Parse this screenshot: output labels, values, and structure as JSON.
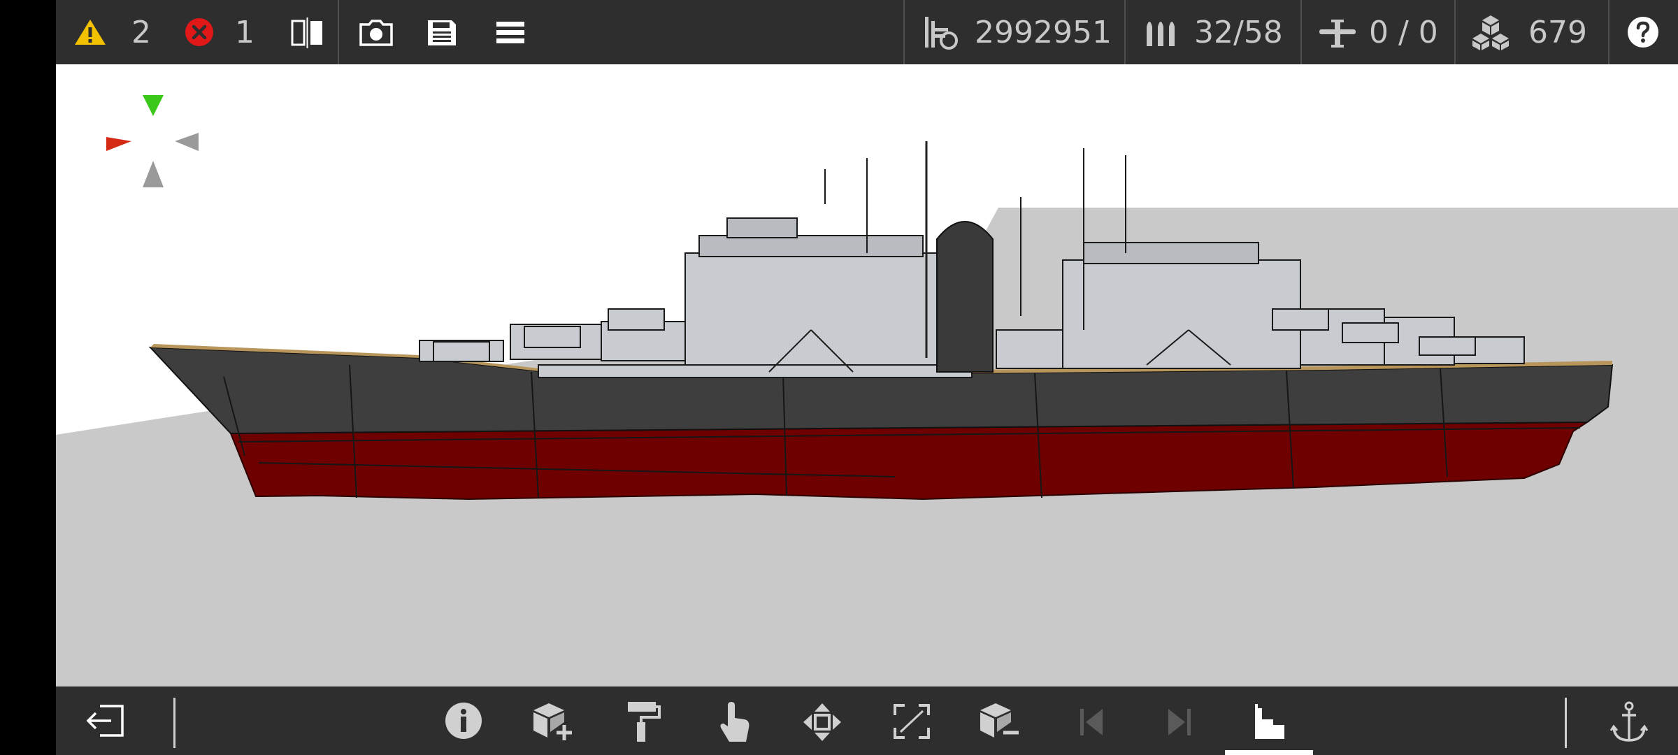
{
  "toolbar": {
    "warnings_count": "2",
    "errors_count": "1",
    "cost_value": "2992951",
    "ammo_value": "32/58",
    "aircraft_value": "0 / 0",
    "parts_value": "679"
  },
  "icons": {
    "warning": "warning-icon",
    "error": "error-icon",
    "mirror": "mirror-view-icon",
    "camera": "camera-icon",
    "save": "save-icon",
    "menu": "menu-icon",
    "cost": "cost-icon",
    "ammo": "ammo-icon",
    "aircraft": "aircraft-icon",
    "parts": "parts-icon",
    "help": "help-icon",
    "exit": "exit-icon",
    "info": "info-icon",
    "add_part": "add-part-icon",
    "paint": "paint-roller-icon",
    "select": "select-hand-icon",
    "move": "move-icon",
    "scale": "scale-icon",
    "remove_part": "remove-part-icon",
    "prev": "previous-icon",
    "next": "next-icon",
    "structure": "structure-icon",
    "anchor": "anchor-icon"
  },
  "colors": {
    "bar_bg": "#2e2e2e",
    "warning": "#f2c200",
    "error": "#e01818",
    "hull": "#3e3e3e",
    "hull_red": "#6e0000",
    "superstructure": "#c8ccd0",
    "deck": "#b8955a",
    "sky": "#ffffff",
    "ground": "#c9c9c9"
  }
}
